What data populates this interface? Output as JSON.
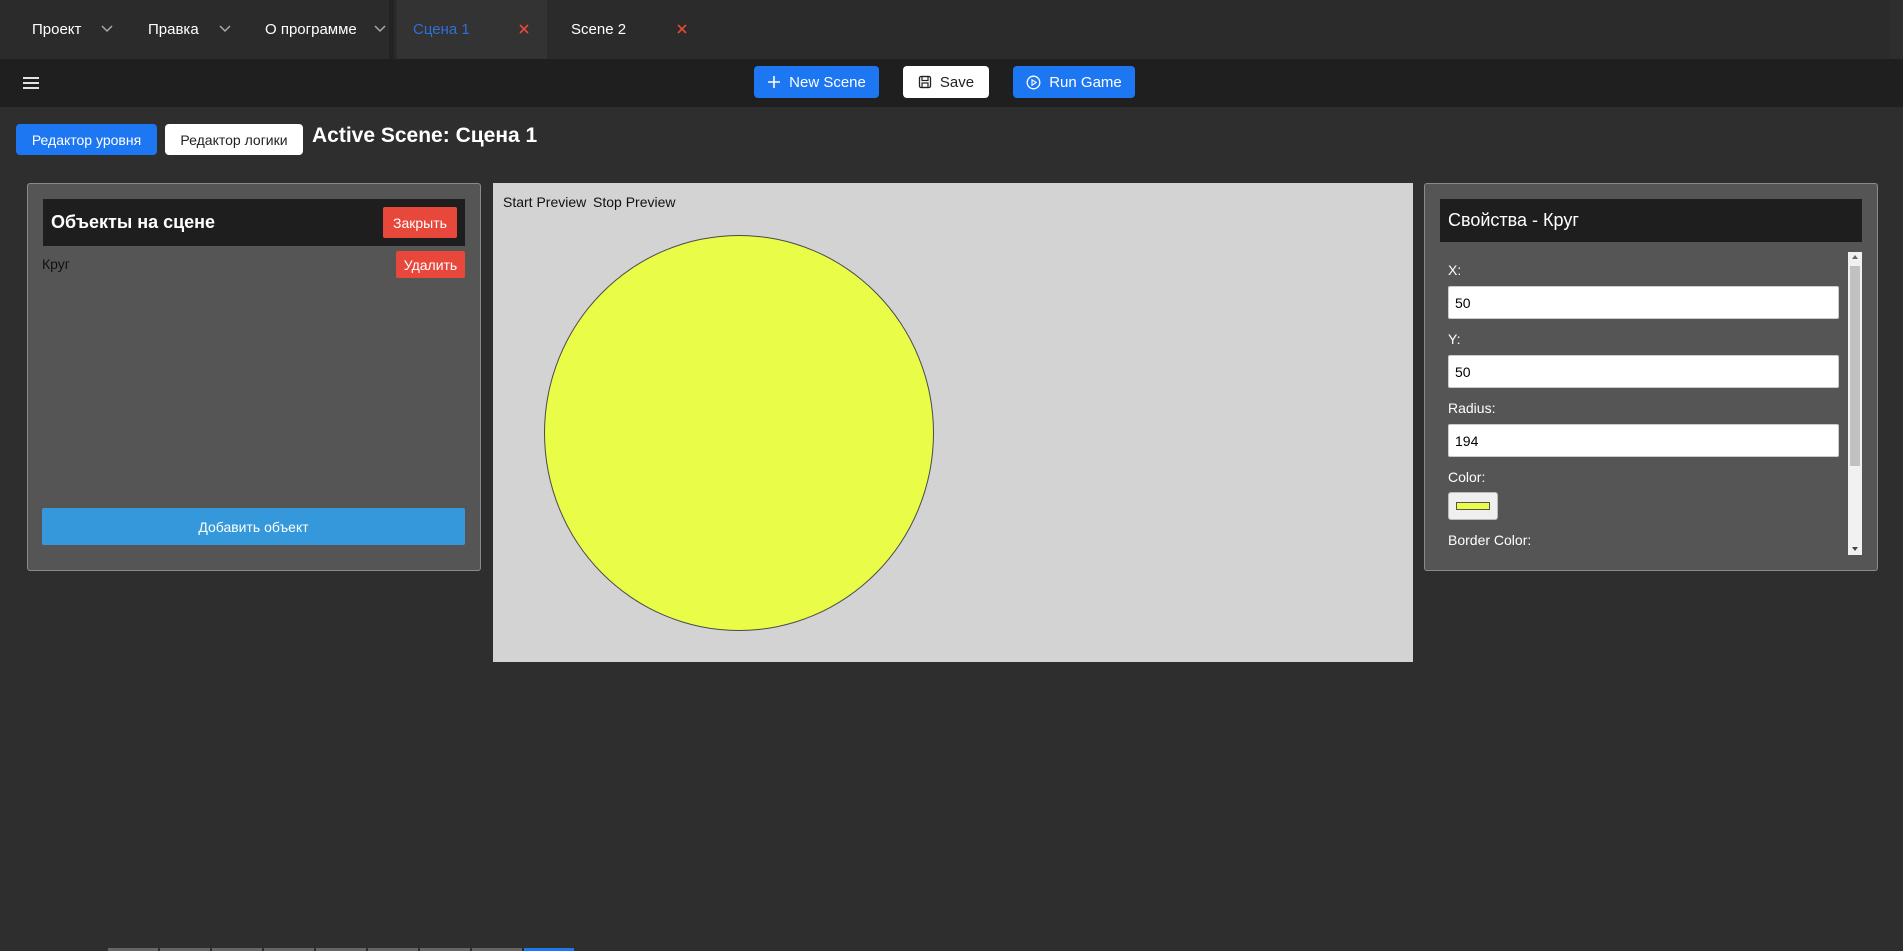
{
  "menu": {
    "items": [
      {
        "label": "Проект"
      },
      {
        "label": "Правка"
      },
      {
        "label": "О программе"
      }
    ]
  },
  "tabs": [
    {
      "label": "Сцена 1",
      "active": true
    },
    {
      "label": "Scene 2",
      "active": false
    }
  ],
  "toolbar": {
    "new_scene": "New Scene",
    "save": "Save",
    "run_game": "Run Game"
  },
  "modes": {
    "level_editor": "Редактор уровня",
    "logic_editor": "Редактор логики"
  },
  "active_scene_title": "Active Scene: Сцена 1",
  "objects_panel": {
    "title": "Объекты на сцене",
    "close": "Закрыть",
    "items": [
      {
        "name": "Круг",
        "delete": "Удалить"
      }
    ],
    "add": "Добавить объект"
  },
  "preview": {
    "start": "Start Preview",
    "stop": "Stop Preview",
    "circle_color": "#e9fd48"
  },
  "properties": {
    "title": "Свойства - Круг",
    "x_label": "X:",
    "x_value": "50",
    "y_label": "Y:",
    "y_value": "50",
    "radius_label": "Radius:",
    "radius_value": "194",
    "color_label": "Color:",
    "color_value": "#e9fd48",
    "border_color_label": "Border Color:"
  },
  "colors": {
    "accent": "#1d77f2",
    "danger": "#e8473b",
    "add_button": "#3498db"
  }
}
